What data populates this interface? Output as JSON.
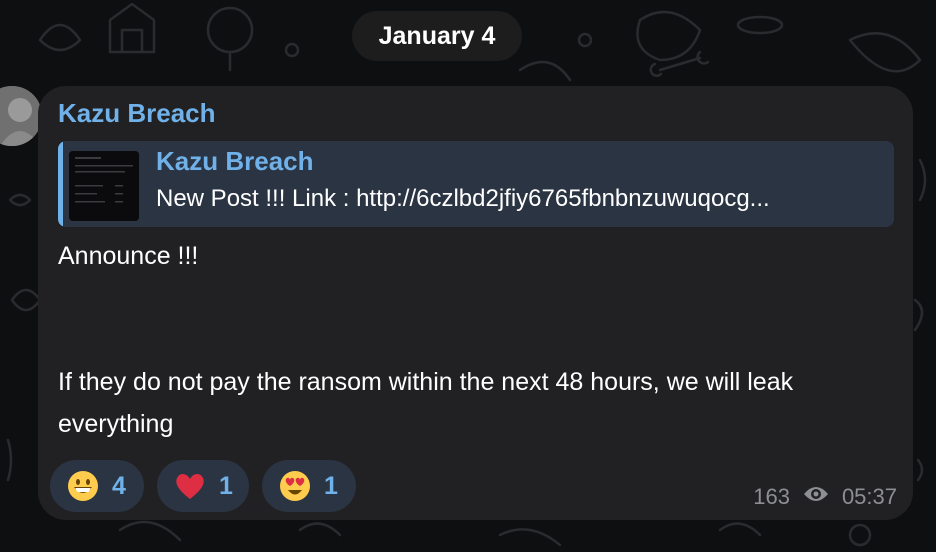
{
  "date_label": "January 4",
  "message": {
    "sender": "Kazu Breach",
    "reply": {
      "author": "Kazu Breach",
      "text": "New Post !!! Link : http://6czlbd2jfiy6765fbnbnzuwuqocg..."
    },
    "text_line1": "Announce !!!",
    "text_line2": "If they do not pay the ransom within the next 48 hours, we will leak everything",
    "reactions": [
      {
        "icon": "grinning-face-emoji",
        "count": "4"
      },
      {
        "icon": "red-heart-emoji",
        "count": "1"
      },
      {
        "icon": "heart-eyes-emoji",
        "count": "1"
      }
    ],
    "views": "163",
    "time": "05:37"
  },
  "colors": {
    "background": "#0e0f11",
    "bubble": "#212124",
    "accent": "#6fb1e8",
    "reaction_bg": "#2b3442",
    "meta": "#8d8f93"
  }
}
